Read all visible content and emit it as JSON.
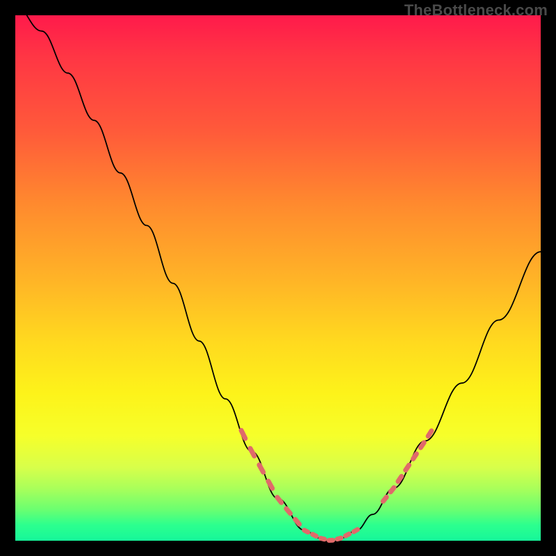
{
  "watermark": "TheBottleneck.com",
  "colors": {
    "background": "#000000",
    "curve": "#000000",
    "markers": "#e06a6a"
  },
  "chart_data": {
    "type": "line",
    "title": "",
    "xlabel": "",
    "ylabel": "",
    "xlim": [
      0,
      1
    ],
    "ylim": [
      0,
      1
    ],
    "grid": false,
    "legend": false,
    "note": "Axes have no tick labels; x roughly 0..1 across width, y roughly 0..1 bottom..top. Curve shows bottleneck %: high on left, dips to ~0 around x≈0.55–0.65, rises toward right. Values estimated from pixel positions.",
    "series": [
      {
        "name": "bottleneck-curve",
        "x": [
          0.0,
          0.05,
          0.1,
          0.15,
          0.2,
          0.25,
          0.3,
          0.35,
          0.4,
          0.45,
          0.5,
          0.55,
          0.58,
          0.6,
          0.62,
          0.65,
          0.68,
          0.72,
          0.78,
          0.85,
          0.92,
          1.0
        ],
        "y": [
          1.02,
          0.97,
          0.89,
          0.8,
          0.7,
          0.6,
          0.49,
          0.38,
          0.27,
          0.17,
          0.08,
          0.02,
          0.005,
          0.0,
          0.005,
          0.02,
          0.05,
          0.1,
          0.19,
          0.3,
          0.42,
          0.55
        ]
      }
    ],
    "highlighted_ranges": [
      {
        "name": "left-approach-markers",
        "x_start": 0.43,
        "x_end": 0.55
      },
      {
        "name": "valley-floor-markers",
        "x_start": 0.55,
        "x_end": 0.66
      },
      {
        "name": "right-rise-markers",
        "x_start": 0.7,
        "x_end": 0.8
      }
    ]
  }
}
